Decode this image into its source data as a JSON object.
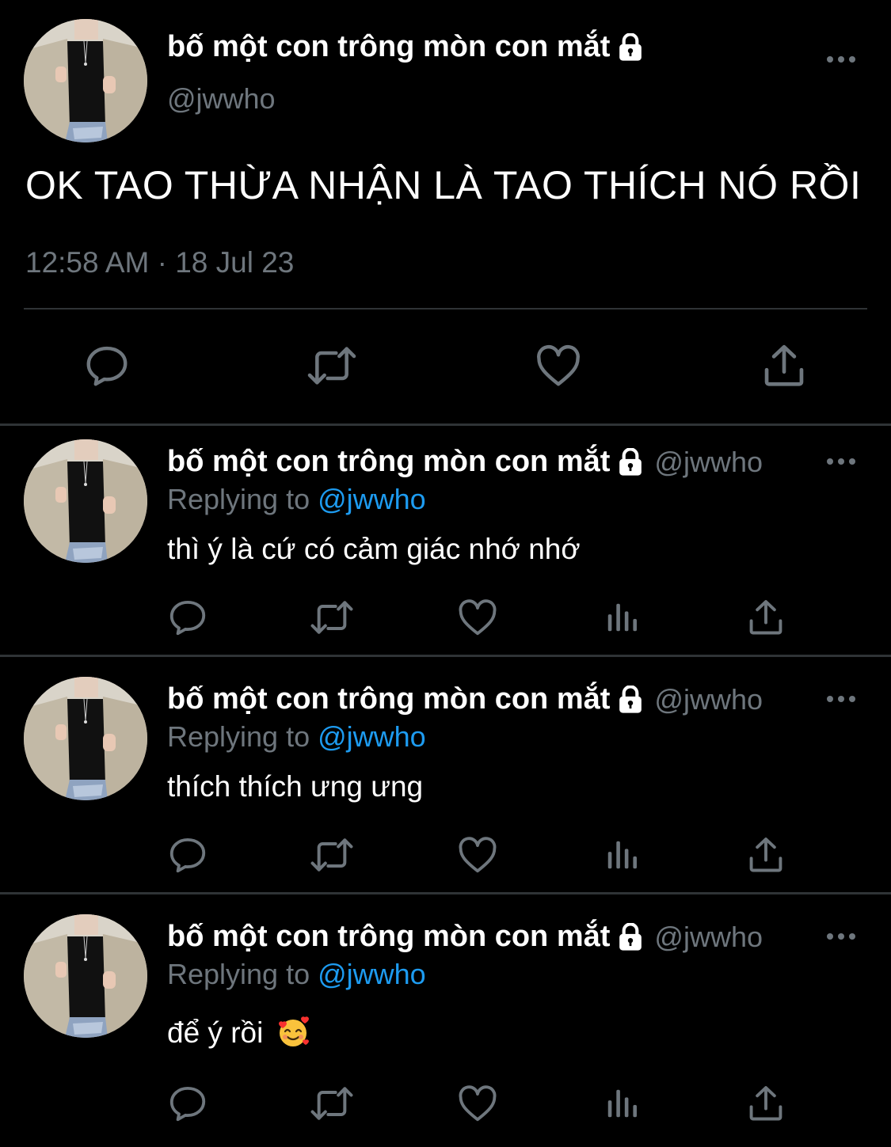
{
  "main_tweet": {
    "display_name": "bố một con trông mòn con mắt",
    "handle": "@jwwho",
    "text": "OK TAO THỪA NHẬN LÀ TAO THÍCH NÓ RỒI",
    "timestamp": "12:58 AM · 18 Jul 23",
    "actions": [
      "reply-icon",
      "retweet-icon",
      "like-icon",
      "share-icon"
    ]
  },
  "replies": [
    {
      "display_name": "bố một con trông mòn con mắt",
      "handle": "@jwwho",
      "replying_label": "Replying to",
      "replying_to": "@jwwho",
      "text": "thì ý là cứ có cảm giác nhớ nhớ"
    },
    {
      "display_name": "bố một con trông mòn con mắt",
      "handle": "@jwwho",
      "replying_label": "Replying to",
      "replying_to": "@jwwho",
      "text": "thích thích ưng ưng"
    },
    {
      "display_name": "bố một con trông mòn con mắt",
      "handle": "@jwwho",
      "replying_label": "Replying to",
      "replying_to": "@jwwho",
      "text": "để ý rồi",
      "emoji": "smiling-face-with-hearts"
    }
  ],
  "colors": {
    "background": "#000000",
    "text": "#ffffff",
    "muted": "#6e767d",
    "accent": "#1d9bf0",
    "divider": "#2f3336"
  }
}
